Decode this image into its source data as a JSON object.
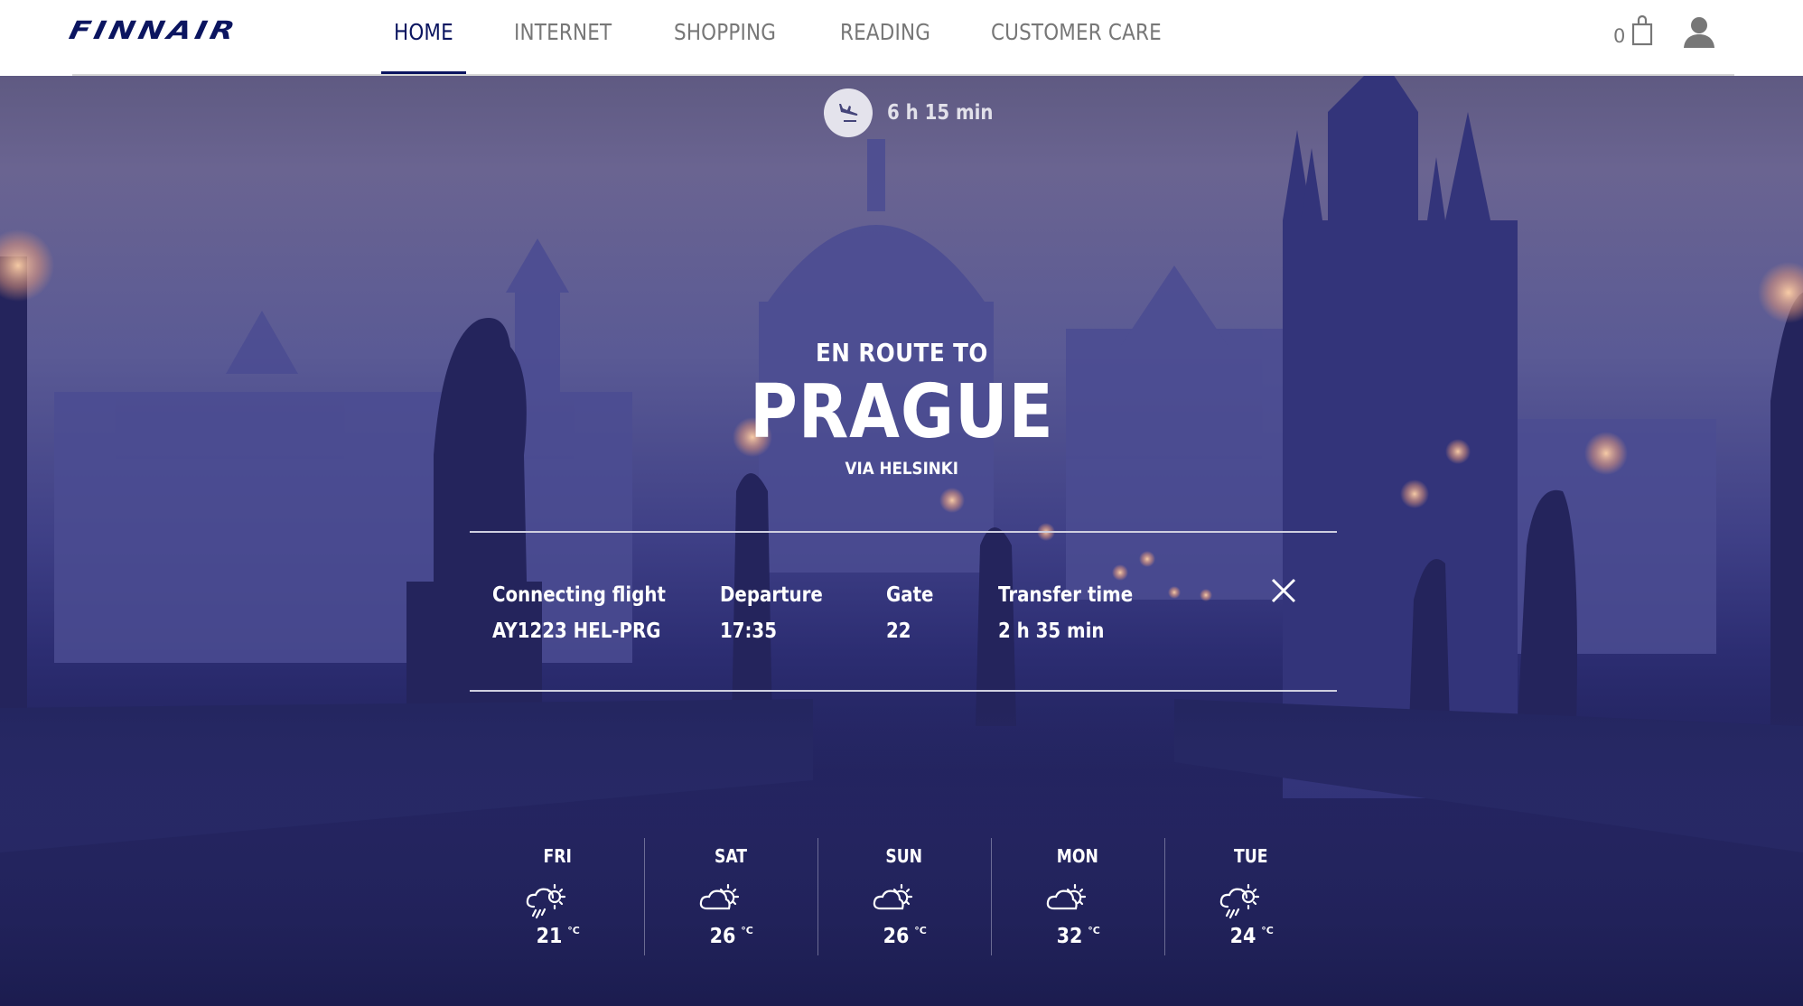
{
  "brand": {
    "name": "FINNAIR",
    "color": "#0b1560"
  },
  "nav": {
    "items": [
      {
        "label": "HOME",
        "active": true
      },
      {
        "label": "INTERNET",
        "active": false
      },
      {
        "label": "SHOPPING",
        "active": false
      },
      {
        "label": "READING",
        "active": false
      },
      {
        "label": "CUSTOMER CARE",
        "active": false
      }
    ],
    "active_color": "#0b1560",
    "inactive_color": "#777777"
  },
  "cart": {
    "count": "0",
    "icon": "shopping-bag-icon"
  },
  "account": {
    "icon": "user-icon"
  },
  "flight": {
    "remaining_icon": "plane-landing-icon",
    "remaining_time": "6 h 15 min",
    "route_prefix": "EN ROUTE TO",
    "destination": "PRAGUE",
    "via": "VIA HELSINKI"
  },
  "connection": {
    "columns": [
      {
        "label": "Connecting flight",
        "value": "AY1223 HEL-PRG"
      },
      {
        "label": "Departure",
        "value": "17:35"
      },
      {
        "label": "Gate",
        "value": "22"
      },
      {
        "label": "Transfer time",
        "value": "2 h 35 min"
      }
    ],
    "close_icon": "close-icon"
  },
  "weather": {
    "unit": "°C",
    "days": [
      {
        "day": "FRI",
        "temp": "21",
        "condition": "rain-partly-sunny"
      },
      {
        "day": "SAT",
        "temp": "26",
        "condition": "partly-cloudy"
      },
      {
        "day": "SUN",
        "temp": "26",
        "condition": "partly-cloudy"
      },
      {
        "day": "MON",
        "temp": "32",
        "condition": "partly-cloudy"
      },
      {
        "day": "TUE",
        "temp": "24",
        "condition": "rain-partly-sunny"
      }
    ]
  }
}
